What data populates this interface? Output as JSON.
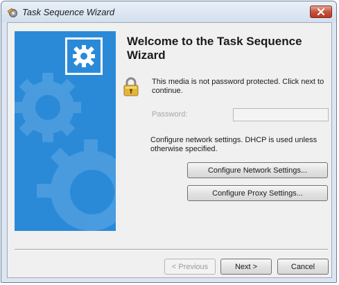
{
  "window": {
    "title": "Task Sequence Wizard",
    "close_symbol": "✕"
  },
  "banner": {
    "logo_icon": "gear-icon",
    "background_color": "#2a8ad8"
  },
  "heading": "Welcome to the Task Sequence Wizard",
  "lock_icon": "padlock-icon",
  "info_text": "This media is not password protected.  Click next to continue.",
  "password": {
    "label": "Password:",
    "value": ""
  },
  "network_text": "Configure network settings. DHCP is used unless otherwise specified.",
  "buttons": {
    "network": "Configure Network Settings...",
    "proxy": "Configure Proxy Settings...",
    "previous": "< Previous",
    "next": "Next >",
    "cancel": "Cancel"
  }
}
